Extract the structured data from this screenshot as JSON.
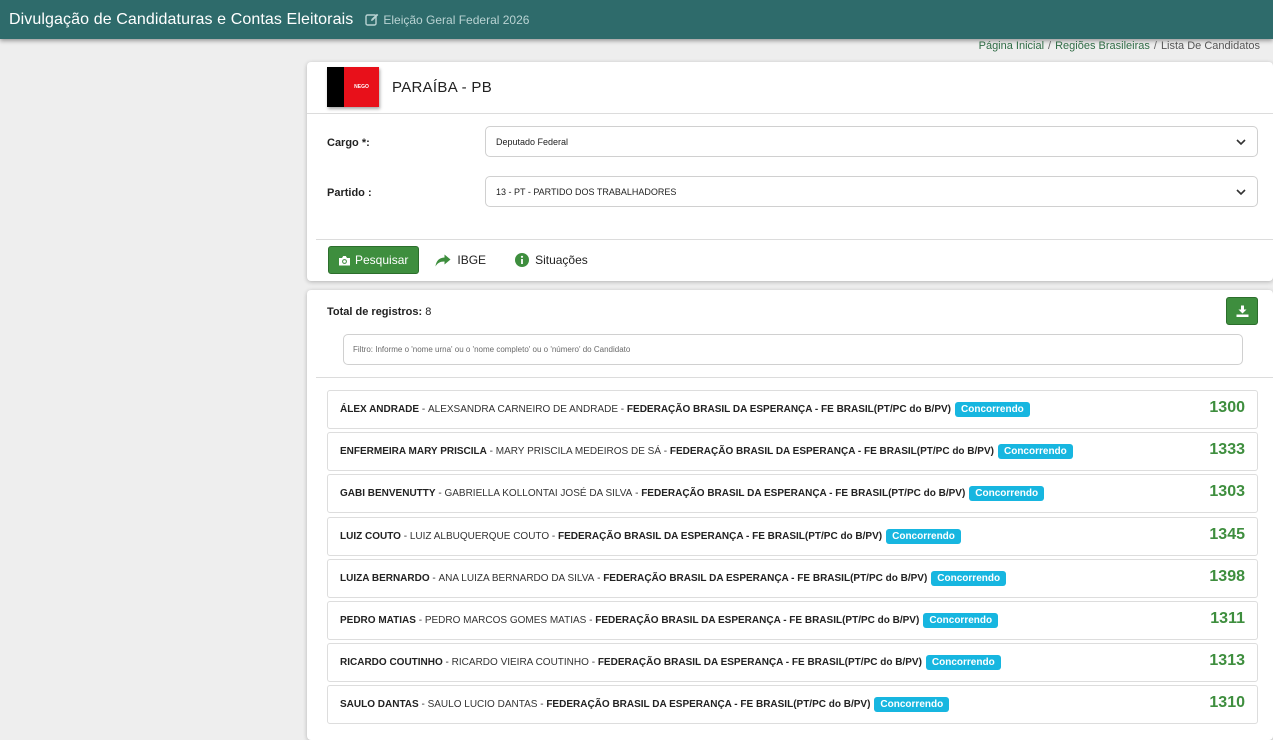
{
  "header": {
    "title": "Divulgação de Candidaturas e Contas Eleitorais",
    "election": "Eleição Geral Federal 2026",
    "election_icon": "edit-icon"
  },
  "breadcrumb": {
    "home": "Página Inicial",
    "regions": "Regiões Brasileiras",
    "current": "Lista De Candidatos",
    "separator": "/"
  },
  "state": {
    "name": "PARAÍBA - PB",
    "flag_text": "NEGO"
  },
  "filters": {
    "cargo_label": "Cargo *:",
    "cargo_value": "Deputado Federal",
    "partido_label": "Partido :",
    "partido_value": "13 - PT - PARTIDO DOS TRABALHADORES"
  },
  "actions": {
    "search_label": "Pesquisar",
    "ibge_label": "IBGE",
    "situacoes_label": "Situações"
  },
  "results": {
    "total_label": "Total de registros:",
    "total_value": "8",
    "filter_placeholder": "Filtro: Informe o 'nome urna' ou o 'nome completo' ou o 'número' do Candidato",
    "candidates": [
      {
        "nick": "ÁLEX ANDRADE",
        "full": "ALEXSANDRA CARNEIRO DE ANDRADE",
        "party": "FEDERAÇÃO BRASIL DA ESPERANÇA - FE BRASIL(PT/PC do B/PV)",
        "status": "Concorrendo",
        "number": "1300"
      },
      {
        "nick": "ENFERMEIRA MARY PRISCILA",
        "full": "MARY PRISCILA MEDEIROS DE SÁ",
        "party": "FEDERAÇÃO BRASIL DA ESPERANÇA - FE BRASIL(PT/PC do B/PV)",
        "status": "Concorrendo",
        "number": "1333"
      },
      {
        "nick": "GABI BENVENUTTY",
        "full": "GABRIELLA KOLLONTAI JOSÉ DA SILVA",
        "party": "FEDERAÇÃO BRASIL DA ESPERANÇA - FE BRASIL(PT/PC do B/PV)",
        "status": "Concorrendo",
        "number": "1303"
      },
      {
        "nick": "LUIZ COUTO",
        "full": "LUIZ ALBUQUERQUE COUTO",
        "party": "FEDERAÇÃO BRASIL DA ESPERANÇA - FE BRASIL(PT/PC do B/PV)",
        "status": "Concorrendo",
        "number": "1345"
      },
      {
        "nick": "LUIZA BERNARDO",
        "full": "ANA LUIZA BERNARDO DA SILVA",
        "party": "FEDERAÇÃO BRASIL DA ESPERANÇA - FE BRASIL(PT/PC do B/PV)",
        "status": "Concorrendo",
        "number": "1398"
      },
      {
        "nick": "PEDRO MATIAS",
        "full": "PEDRO MARCOS GOMES MATIAS",
        "party": "FEDERAÇÃO BRASIL DA ESPERANÇA - FE BRASIL(PT/PC do B/PV)",
        "status": "Concorrendo",
        "number": "1311"
      },
      {
        "nick": "RICARDO COUTINHO",
        "full": "RICARDO VIEIRA COUTINHO",
        "party": "FEDERAÇÃO BRASIL DA ESPERANÇA - FE BRASIL(PT/PC do B/PV)",
        "status": "Concorrendo",
        "number": "1313"
      },
      {
        "nick": "SAULO DANTAS",
        "full": "SAULO LUCIO DANTAS",
        "party": "FEDERAÇÃO BRASIL DA ESPERANÇA - FE BRASIL(PT/PC do B/PV)",
        "status": "Concorrendo",
        "number": "1310"
      }
    ]
  },
  "colors": {
    "header_bg": "#2e6b6b",
    "accent_green": "#3e8e3e",
    "badge_blue": "#17b6e0",
    "flag_red": "#e8101a",
    "flag_black": "#000000"
  }
}
